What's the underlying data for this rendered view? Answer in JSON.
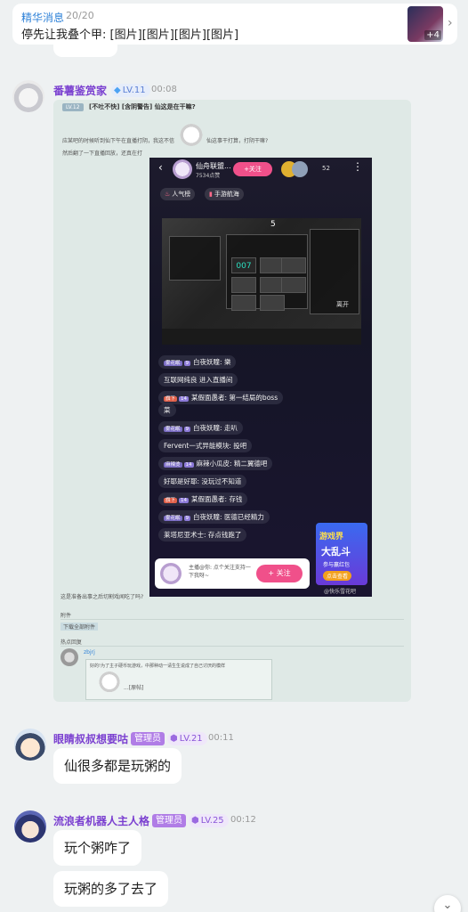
{
  "pinned": {
    "title": "精华消息",
    "count": "20/20",
    "body": "停先让我叠个甲: [图片][图片][图片][图片]",
    "thumb_badge": "+4",
    "more_icon": "chevron-right-icon"
  },
  "messages": [
    {
      "sender": "番薯鉴赏家",
      "level": "LV.11",
      "time": "00:08",
      "post": {
        "tag": "LV.12",
        "title": "[不吐不快] [含阴警告] 仙这是在干嘛?",
        "line1": "应某吧的时候听到仙下午在直播打阴，我这不信",
        "line1b": "仙这事干打算，打阴干嘛?",
        "line2": "然后翻了一下直播回放，还真在打",
        "question": "这是准备出事之后切割戏闻吃了吗?",
        "attachments_label": "附件",
        "download_label": "下载全部附件",
        "hot_reply_label": "热点回复",
        "reply_user": "zbjrj",
        "reply_text": "好的!为了主子硬币玩游戏，中那种动一请生生说成了自己讨厌的模样",
        "reply_more": "...[原帖]"
      },
      "phone": {
        "room_name": "仙舟联盟...",
        "likes": "7534点赞",
        "follow": "+关注",
        "viewer_count": "52",
        "chips": [
          "人气榜",
          "手游航海"
        ],
        "game_text": {
          "title": "5",
          "timer": "007",
          "exit": "离开"
        },
        "comments": [
          {
            "badge": "雾花眠",
            "lv": "9",
            "name": "白夜妖瞳",
            "text": "樂"
          },
          {
            "badge": "",
            "lv": "",
            "name": "",
            "text": "互联网纯良 进入直播间"
          },
          {
            "badge": "旗下",
            "lv": "14",
            "name": "某假面愚者",
            "text": "第一结局的boss"
          },
          {
            "badge": "",
            "lv": "",
            "name": "",
            "text": "菜"
          },
          {
            "badge": "雾花眠",
            "lv": "9",
            "name": "白夜妖瞳",
            "text": "走叭"
          },
          {
            "badge": "",
            "lv": "",
            "name": "",
            "text": "Fervent一式异能模块: 投吧"
          },
          {
            "badge": "麻辣烫",
            "lv": "14",
            "name": "麻辣小瓜皮",
            "text": "精二翼德吧"
          },
          {
            "badge": "",
            "lv": "",
            "name": "",
            "text": "好耶是好耶: 没玩过不知道"
          },
          {
            "badge": "旗下",
            "lv": "14",
            "name": "某假面愚者",
            "text": "存钱"
          },
          {
            "badge": "雾花眠",
            "lv": "9",
            "name": "白夜妖瞳",
            "text": "医德已经精力"
          },
          {
            "badge": "",
            "lv": "",
            "name": "",
            "text": "莱塔尼亚术士: 存点钱跑了"
          }
        ],
        "popup_text": "主播@你: 点个关注支持一下我呀~",
        "popup_button": "+ 关注",
        "ad": {
          "t1": "游戏界",
          "t2": "大乱斗",
          "t3": "参与赢红包",
          "t4": "点击查看"
        },
        "watermark": "@快乐雪花吧"
      }
    },
    {
      "sender": "眼睛叔叔想要咕",
      "role": "管理员",
      "level": "LV.21",
      "time": "00:11",
      "texts": [
        "仙很多都是玩粥的"
      ]
    },
    {
      "sender": "流浪者机器人主人格",
      "role": "管理员",
      "level": "LV.25",
      "time": "00:12",
      "texts": [
        "玩个粥咋了",
        "玩粥的多了去了"
      ]
    }
  ],
  "scroll_icon": "double-chevron-down-icon",
  "colors": {
    "accent": "#2f82d8",
    "username": "#7a3fd0",
    "follow": "#f0508a",
    "background": "#eef1f2"
  }
}
